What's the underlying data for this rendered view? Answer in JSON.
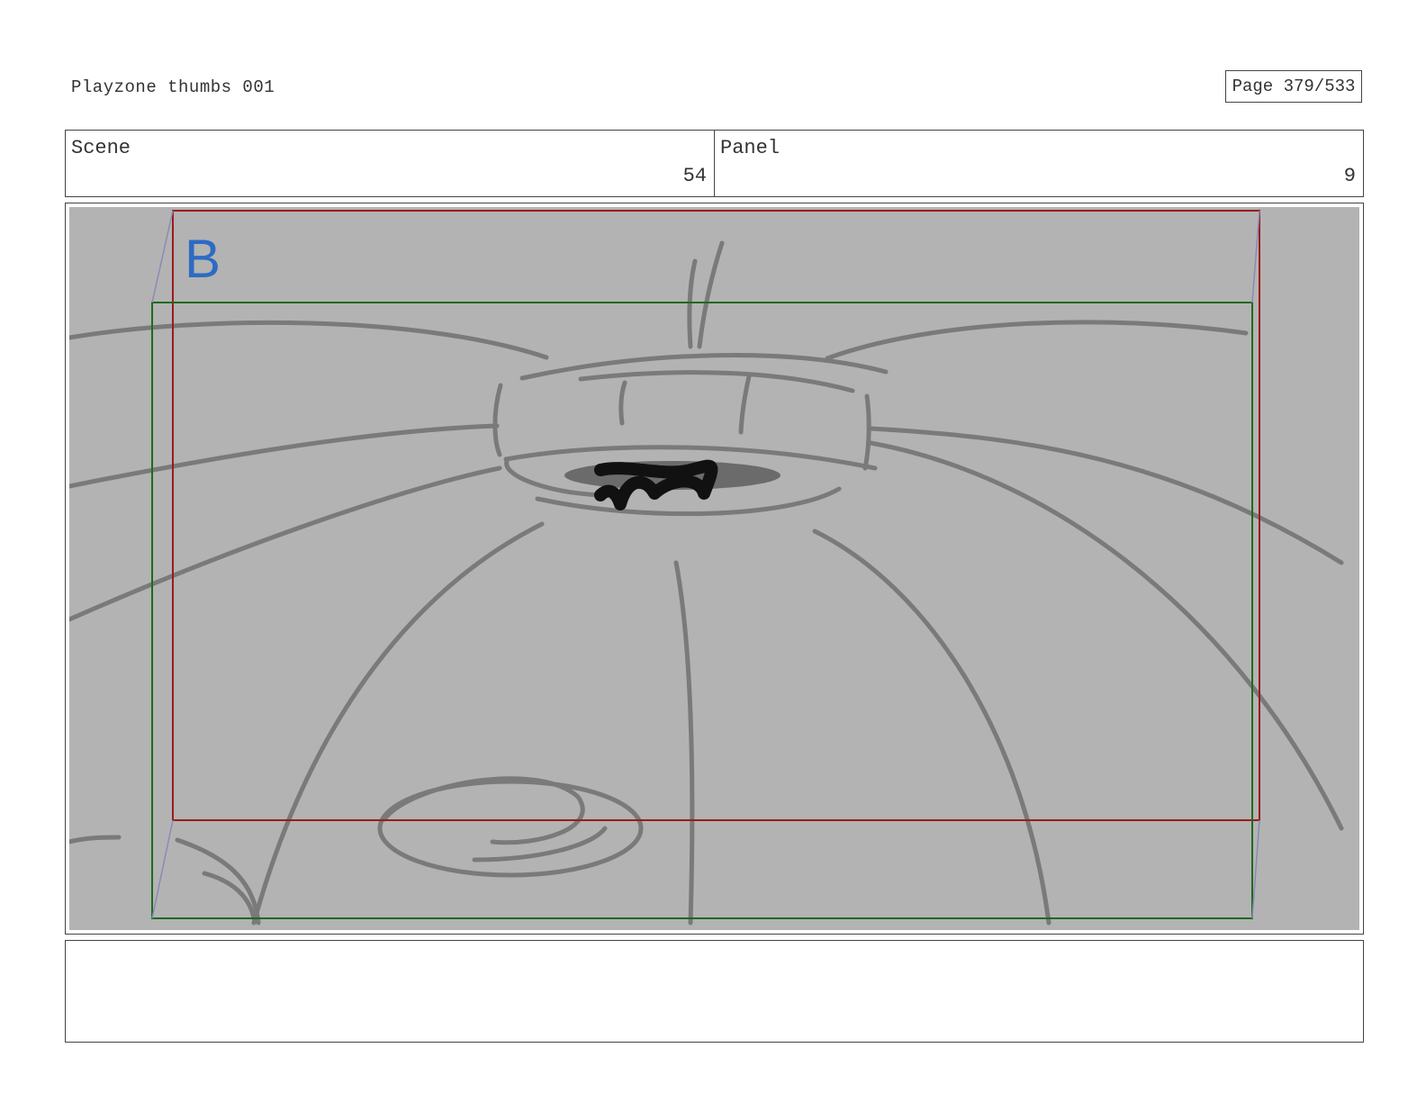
{
  "document": {
    "title": "Playzone thumbs 001",
    "page": "Page 379/533"
  },
  "panel_info": {
    "scene_label": "Scene",
    "scene_value": "54",
    "panel_label": "Panel",
    "panel_value": "9"
  },
  "frame": {
    "marker": "B",
    "marker_color": "#2d6bc4",
    "background_color": "#b3b3b3",
    "sketch_color": "#7a7a7a",
    "red_frame_color": "#9b1b1b",
    "green_frame_color": "#1e6a1e"
  },
  "notes": {
    "text": ""
  }
}
